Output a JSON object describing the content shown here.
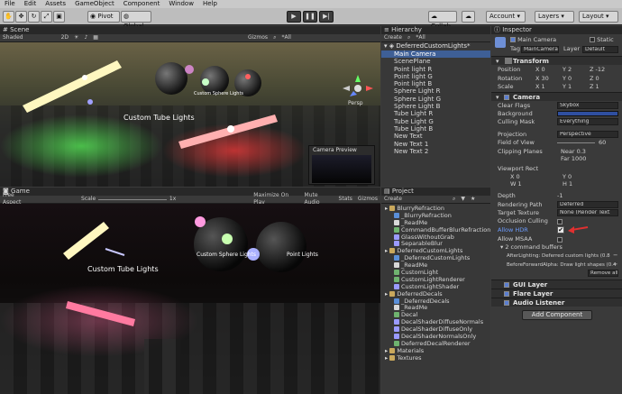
{
  "menu": [
    "File",
    "Edit",
    "Assets",
    "GameObject",
    "Component",
    "Window",
    "Help"
  ],
  "toolbar": {
    "pivot": "Pivot",
    "global": "Global",
    "collab": "Collab",
    "account": "Account",
    "layers": "Layers",
    "layout": "Layout"
  },
  "scene": {
    "tab": "Scene",
    "shading": "Shaded",
    "mode2d": "2D",
    "gizmos": "Gizmos",
    "search": "*All",
    "persp": "Persp",
    "labels": {
      "tube": "Custom Tube Lights",
      "sphere": "Custom Sphere Lights",
      "point": "Point Lights"
    },
    "camera_preview": "Camera Preview"
  },
  "game": {
    "tab": "Game",
    "aspect": "Free Aspect",
    "scale_label": "Scale",
    "scale_value": "1x",
    "maximize": "Maximize On Play",
    "mute": "Mute Audio",
    "stats": "Stats",
    "gizmos": "Gizmos",
    "labels": {
      "tube": "Custom Tube Lights",
      "sphere": "Custom Sphere Lights",
      "point": "Point Lights"
    }
  },
  "hierarchy": {
    "tab": "Hierarchy",
    "create": "Create",
    "search": "*All",
    "scene_name": "DeferredCustomLights*",
    "items": [
      "Main Camera",
      "ScenePlane",
      "Point light R",
      "Point light G",
      "Point light B",
      "Sphere Light R",
      "Sphere Light G",
      "Sphere Light B",
      "Tube Light R",
      "Tube Light G",
      "Tube Light B",
      "New Text",
      "New Text 1",
      "New Text 2"
    ]
  },
  "project": {
    "tab": "Project",
    "create": "Create",
    "items": [
      {
        "label": "BlurryRefraction",
        "type": "folder",
        "indent": 0
      },
      {
        "label": "_BlurryRefraction",
        "type": "scene",
        "indent": 1
      },
      {
        "label": "_ReadMe",
        "type": "text",
        "indent": 1
      },
      {
        "label": "CommandBufferBlurRefraction",
        "type": "script",
        "indent": 1
      },
      {
        "label": "GlassWithoutGrab",
        "type": "shader",
        "indent": 1
      },
      {
        "label": "SeparableBlur",
        "type": "shader",
        "indent": 1
      },
      {
        "label": "DeferredCustomLights",
        "type": "folder",
        "indent": 0
      },
      {
        "label": "_DeferredCustomLights",
        "type": "scene",
        "indent": 1
      },
      {
        "label": "_ReadMe",
        "type": "text",
        "indent": 1
      },
      {
        "label": "CustomLight",
        "type": "script",
        "indent": 1
      },
      {
        "label": "CustomLightRenderer",
        "type": "script",
        "indent": 1
      },
      {
        "label": "CustomLightShader",
        "type": "shader",
        "indent": 1
      },
      {
        "label": "DeferredDecals",
        "type": "folder",
        "indent": 0
      },
      {
        "label": "_DeferredDecals",
        "type": "scene",
        "indent": 1
      },
      {
        "label": "_ReadMe",
        "type": "text",
        "indent": 1
      },
      {
        "label": "Decal",
        "type": "script",
        "indent": 1
      },
      {
        "label": "DecalShaderDiffuseNormals",
        "type": "shader",
        "indent": 1
      },
      {
        "label": "DecalShaderDiffuseOnly",
        "type": "shader",
        "indent": 1
      },
      {
        "label": "DecalShaderNormalsOnly",
        "type": "shader",
        "indent": 1
      },
      {
        "label": "DeferredDecalRenderer",
        "type": "script",
        "indent": 1
      },
      {
        "label": "Materials",
        "type": "folder",
        "indent": 0
      },
      {
        "label": "Textures",
        "type": "folder",
        "indent": 0
      }
    ]
  },
  "inspector": {
    "tab": "Inspector",
    "object_name": "Main Camera",
    "static_label": "Static",
    "tag_label": "Tag",
    "tag_value": "MainCamera",
    "layer_label": "Layer",
    "layer_value": "Default",
    "transform": {
      "title": "Transform",
      "position_label": "Position",
      "position": [
        "X 0",
        "Y 2",
        "Z -12"
      ],
      "rotation_label": "Rotation",
      "rotation": [
        "X 30",
        "Y 0",
        "Z 0"
      ],
      "scale_label": "Scale",
      "scale": [
        "X 1",
        "Y 1",
        "Z 1"
      ]
    },
    "camera": {
      "title": "Camera",
      "clear_flags": "Clear Flags",
      "clear_flags_value": "Skybox",
      "background": "Background",
      "culling_mask": "Culling Mask",
      "culling_mask_value": "Everything",
      "projection": "Projection",
      "projection_value": "Perspective",
      "fov": "Field of View",
      "fov_value": "60",
      "clipping": "Clipping Planes",
      "near": "Near",
      "near_value": "0.3",
      "far": "Far",
      "far_value": "1000",
      "viewport": "Viewport Rect",
      "vx": "X 0",
      "vy": "Y 0",
      "vw": "W 1",
      "vh": "H 1",
      "depth": "Depth",
      "depth_value": "-1",
      "rendering_path": "Rendering Path",
      "rendering_path_value": "Deferred",
      "target_texture": "Target Texture",
      "target_texture_value": "None (Render Text",
      "occlusion": "Occlusion Culling",
      "allow_hdr": "Allow HDR",
      "allow_msaa": "Allow MSAA",
      "cmd_buffers": "2 command buffers",
      "cmd1": "AfterLighting: Deferred custom lights (0.8",
      "cmd2": "BeforeForwardAlpha: Draw light shapes (0.4",
      "remove_all": "Remove all"
    },
    "gui_layer": "GUI Layer",
    "flare_layer": "Flare Layer",
    "audio_listener": "Audio Listener",
    "add_component": "Add Component"
  }
}
